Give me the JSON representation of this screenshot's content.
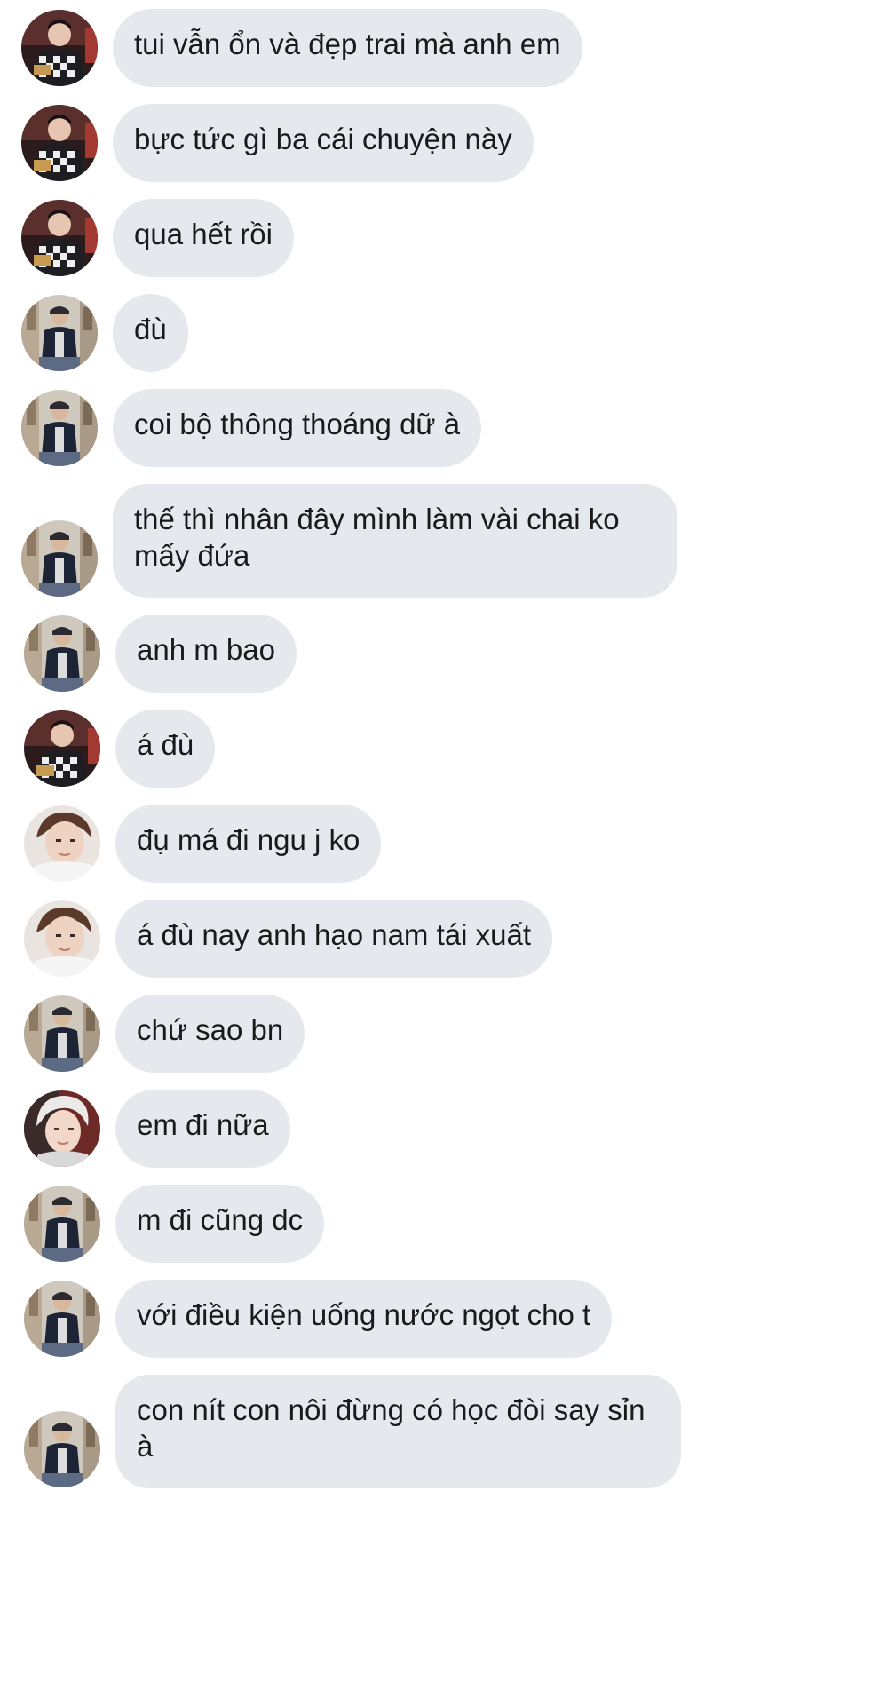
{
  "messages": [
    {
      "sender": "checker-jacket",
      "text": "tui vẫn ổn và đẹp trai mà anh em"
    },
    {
      "sender": "checker-jacket",
      "text": "bực tức gì ba cái chuyện này"
    },
    {
      "sender": "checker-jacket",
      "text": "qua hết rồi"
    },
    {
      "sender": "street-photo",
      "text": "đù"
    },
    {
      "sender": "street-photo",
      "text": "coi bộ thông thoáng dữ à"
    },
    {
      "sender": "street-photo",
      "text": "thế thì nhân đây mình làm vài chai ko mấy đứa"
    },
    {
      "sender": "street-photo",
      "text": "anh m bao"
    },
    {
      "sender": "checker-jacket",
      "text": "á đù"
    },
    {
      "sender": "portrait-boy",
      "text": "đụ má đi ngu j ko"
    },
    {
      "sender": "portrait-boy",
      "text": "á đù nay anh hạo nam tái xuất"
    },
    {
      "sender": "street-photo",
      "text": "chứ sao bn"
    },
    {
      "sender": "blond-boy",
      "text": "em đi nữa"
    },
    {
      "sender": "street-photo",
      "text": "m đi cũng dc"
    },
    {
      "sender": "street-photo",
      "text": "với điều kiện uống nước ngọt cho t"
    },
    {
      "sender": "street-photo",
      "text": "con nít con nôi đừng có học đòi say sỉn à"
    }
  ],
  "colors": {
    "bubble": "#e5e9ee",
    "text": "#1a1a1a",
    "background": "#ffffff"
  }
}
